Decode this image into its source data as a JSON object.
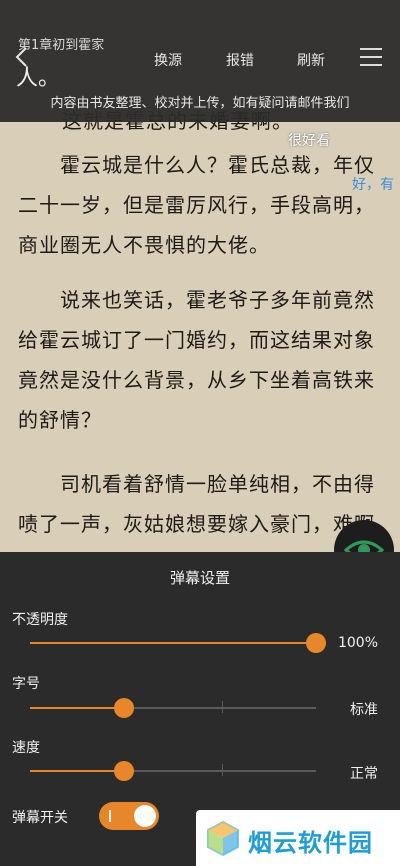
{
  "reader": {
    "overflow_line": "人。",
    "paragraphs": [
      "这就是霍总的未婚妻啊。",
      "霍云城是什么人？霍氏总裁，年仅二十一岁，但是雷厉风行，手段高明，商业圈无人不畏惧的大佬。",
      "说来也笑话，霍老爷子多年前竟然给霍云城订了一门婚约，而这结果对象竟然是没什么背景，从乡下坐着高铁来的舒情？",
      "司机看着舒情一脸单纯相，不由得啧了一声，灰姑娘想要嫁入豪门，难啊"
    ]
  },
  "topbar": {
    "chapter_title": "第1章初到霍家",
    "actions": [
      "换源",
      "报错",
      "刷新"
    ],
    "notice": "内容由书友整理、校对并上传，如有疑问请邮件我们"
  },
  "danmaku": [
    {
      "text": "很好看",
      "color": "#ffffff"
    },
    {
      "text": "好，有",
      "color": "#3a8fd9"
    }
  ],
  "panel": {
    "title": "弹幕设置",
    "opacity": {
      "label": "不透明度",
      "value_text": "100%",
      "level": 1.0
    },
    "font_size": {
      "label": "字号",
      "value_text": "标准",
      "level": 0.33
    },
    "speed": {
      "label": "速度",
      "value_text": "正常",
      "level": 0.33
    },
    "switch": {
      "label": "弹幕开关",
      "on": true
    }
  },
  "watermark": {
    "text": "烟云软件园"
  },
  "colors": {
    "accent": "#e8862a",
    "panel_bg": "#2b2b2b",
    "paper": "#d9cfb9"
  }
}
